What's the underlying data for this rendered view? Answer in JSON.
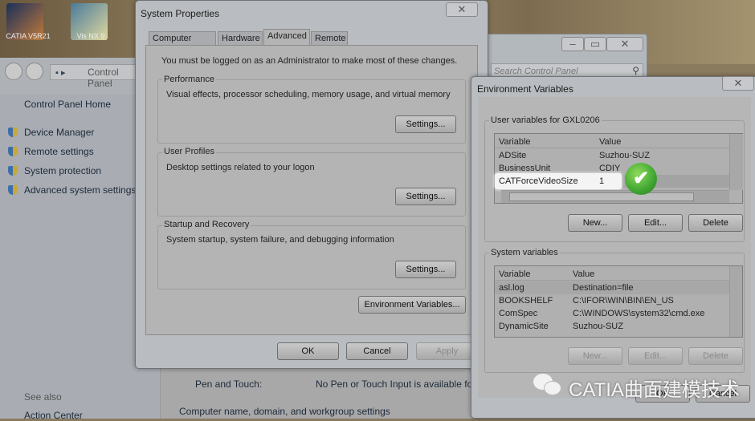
{
  "desktop": {
    "icons": [
      {
        "label": "CATIA V5R21"
      },
      {
        "label": "Vis NX 9"
      }
    ]
  },
  "control_panel": {
    "breadcrumb": "Control Panel",
    "search_placeholder": "Search Control Panel",
    "nav": {
      "home": "Control Panel Home",
      "items": [
        "Device Manager",
        "Remote settings",
        "System protection",
        "Advanced system settings"
      ],
      "see_also": "See also",
      "see_also_items": [
        "Action Center"
      ]
    },
    "main": {
      "pen_touch_label": "Pen and Touch:",
      "pen_touch_value": "No Pen or Touch Input is available fo",
      "section": "Computer name, domain, and workgroup settings"
    }
  },
  "system_properties": {
    "title": "System Properties",
    "tabs": [
      "Computer Name",
      "Hardware",
      "Advanced",
      "Remote"
    ],
    "active_tab": "Advanced",
    "admin_note": "You must be logged on as an Administrator to make most of these changes.",
    "groups": [
      {
        "label": "Performance",
        "desc": "Visual effects, processor scheduling, memory usage, and virtual memory",
        "button": "Settings..."
      },
      {
        "label": "User Profiles",
        "desc": "Desktop settings related to your logon",
        "button": "Settings..."
      },
      {
        "label": "Startup and Recovery",
        "desc": "System startup, system failure, and debugging information",
        "button": "Settings..."
      }
    ],
    "env_button": "Environment Variables...",
    "ok": "OK",
    "cancel": "Cancel",
    "apply": "Apply"
  },
  "env_vars": {
    "title": "Environment Variables",
    "user_label": "User variables for GXL0206",
    "columns": [
      "Variable",
      "Value"
    ],
    "user_rows": [
      [
        "ADSite",
        "Suzhou-SUZ"
      ],
      [
        "BusinessUnit",
        "CDIY"
      ],
      [
        "CATForceVideoSize",
        "1"
      ]
    ],
    "highlighted_row": "CATForceVideoSize",
    "user_buttons": [
      "New...",
      "Edit...",
      "Delete"
    ],
    "system_label": "System variables",
    "system_rows": [
      [
        "asl.log",
        "Destination=file"
      ],
      [
        "BOOKSHELF",
        "C:\\IFOR\\WIN\\BIN\\EN_US"
      ],
      [
        "ComSpec",
        "C:\\WINDOWS\\system32\\cmd.exe"
      ],
      [
        "DynamicSite",
        "Suzhou-SUZ"
      ]
    ],
    "system_buttons": [
      "New...",
      "Edit...",
      "Delete"
    ],
    "ok": "OK",
    "cancel": "Cancel"
  },
  "watermark": "CATIA曲面建模技术",
  "colors": {
    "check": "#3fa532"
  }
}
